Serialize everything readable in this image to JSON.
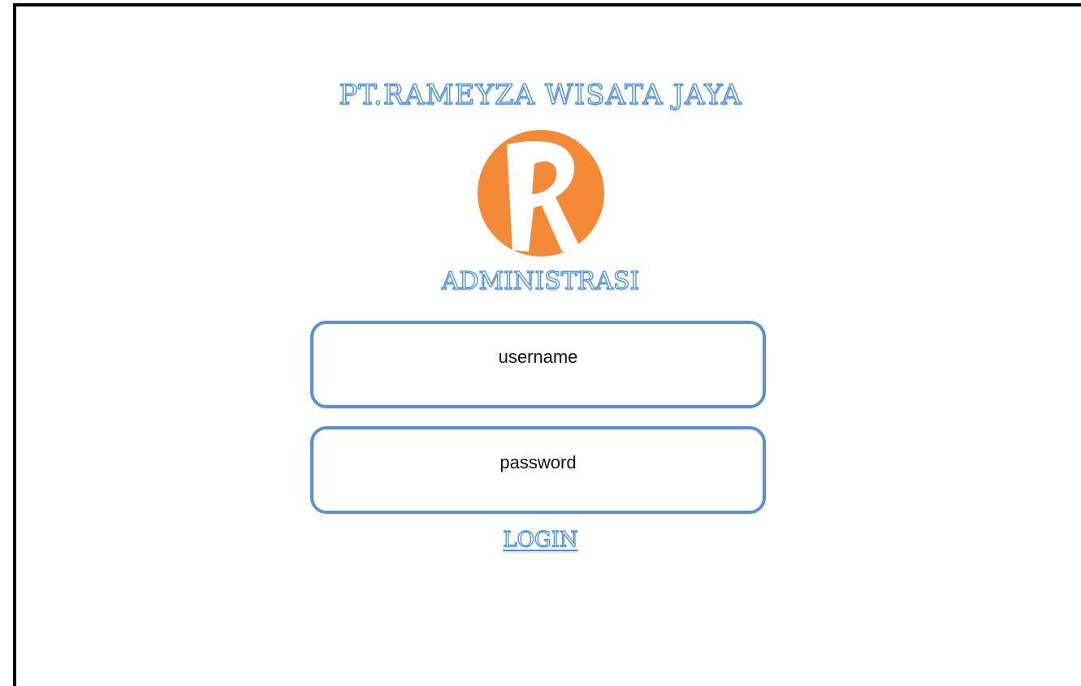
{
  "header": {
    "company_name": "PT.RAMEYZA WISATA JAYA",
    "section_title": "ADMINISTRASI"
  },
  "logo": {
    "letter": "R",
    "icon": "r-logo-icon",
    "color": "#f28a38"
  },
  "form": {
    "username_label": "username",
    "password_label": "password",
    "login_label": "LOGIN",
    "field_border_color": "#5b8fd3"
  }
}
